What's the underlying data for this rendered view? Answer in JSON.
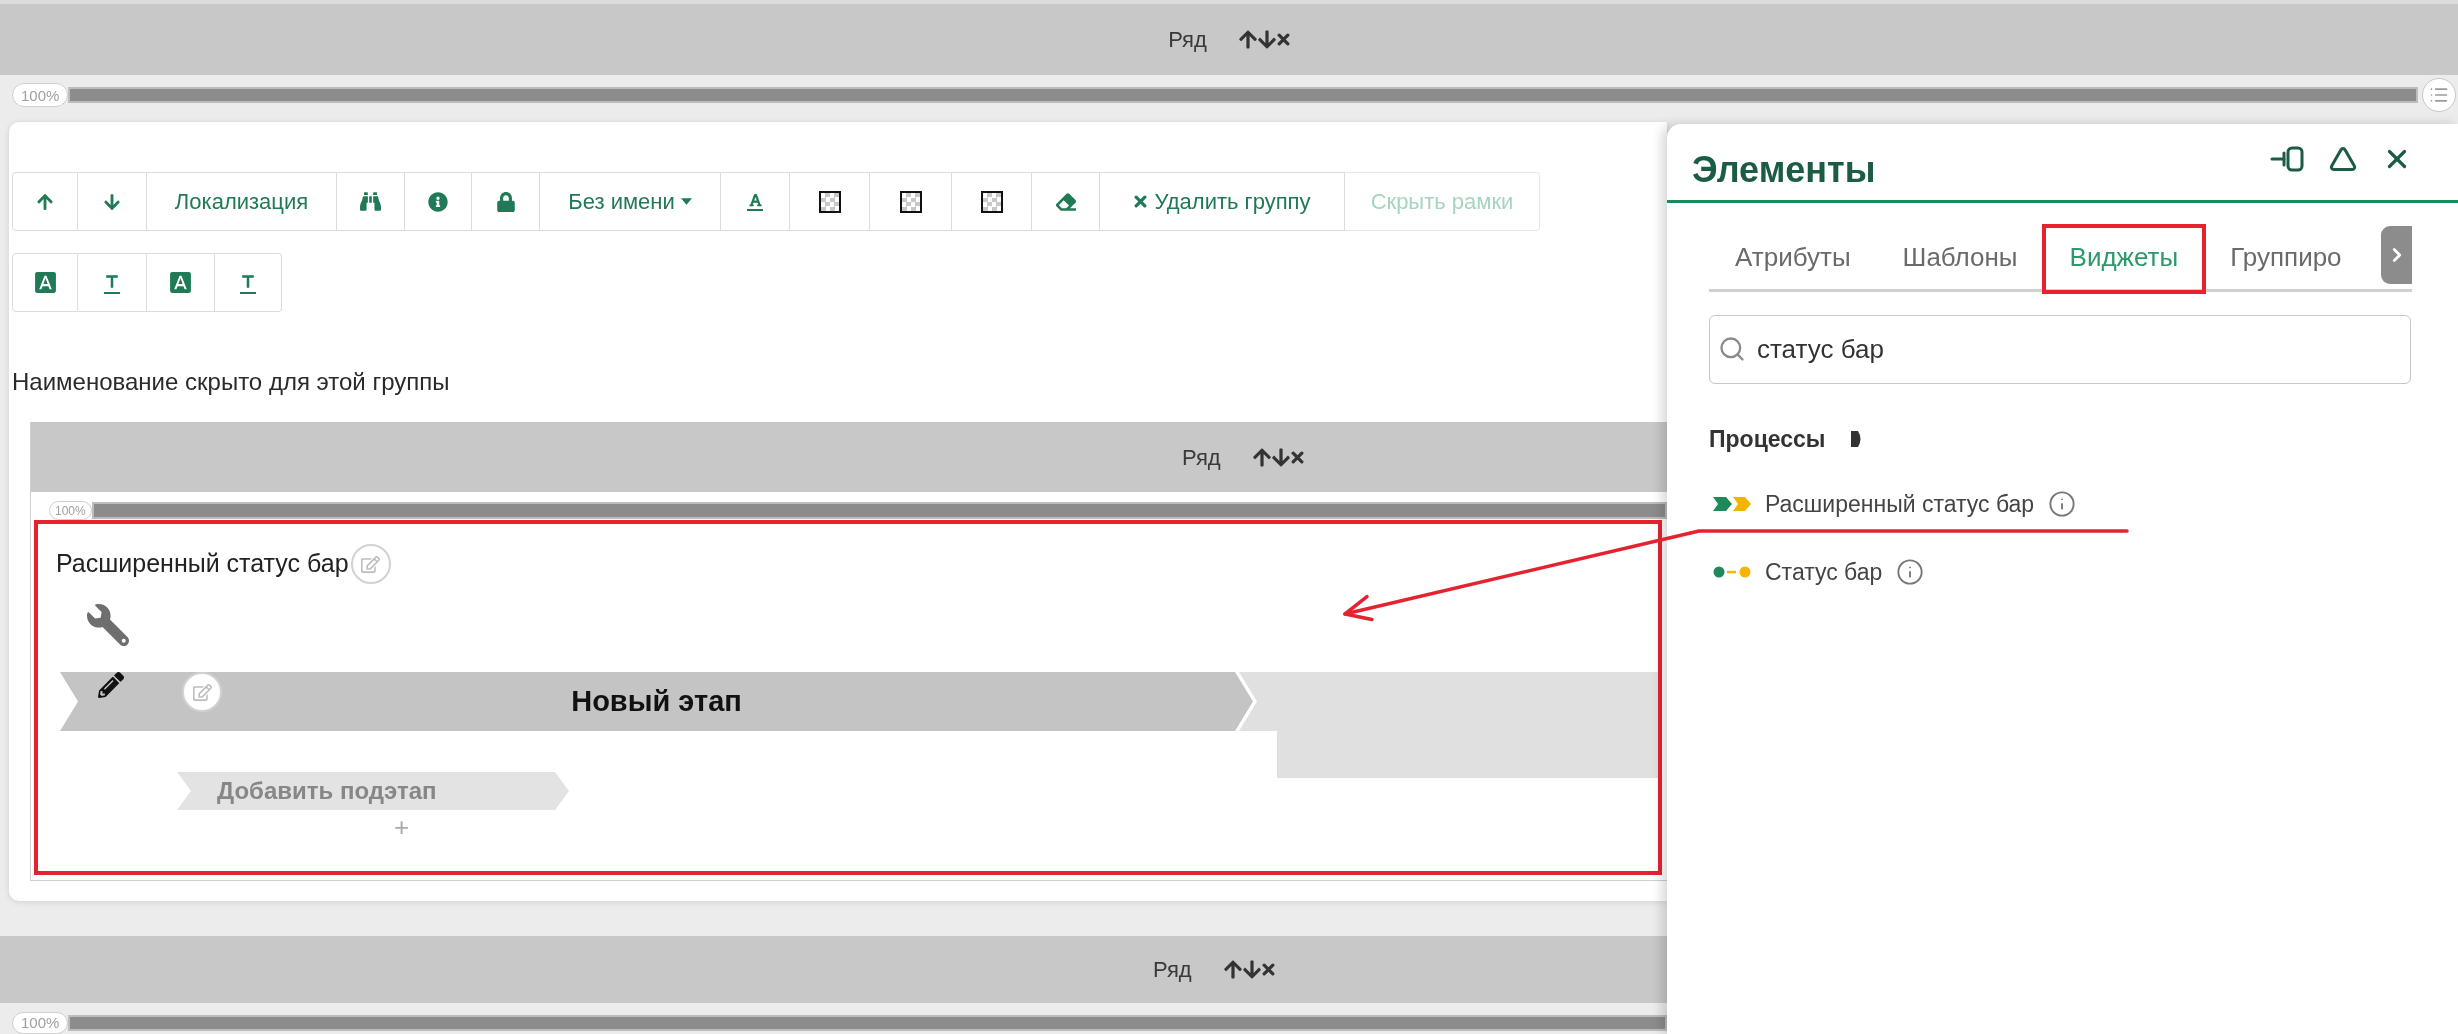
{
  "top_row": {
    "label": "Ряд",
    "width_badge": "100%",
    "level": 1
  },
  "group": {
    "toolbar": {
      "localization": "Локализация",
      "name_menu": "Без имени",
      "delete_group": "Удалить группу",
      "hide_frames": {
        "label": "Скрыть рамки",
        "disabled": true
      }
    },
    "caption": "Наименование скрыто для этой группы",
    "row": {
      "label": "Ряд",
      "width_badge": "100%",
      "level": 1
    },
    "widget": {
      "title": "Расширенный статус бар",
      "stage": {
        "label": "Новый этап"
      },
      "add_substage": "Добавить подэтап",
      "add_button": "+"
    }
  },
  "bottom_row": {
    "label": "Ряд",
    "width_badge": "100%",
    "level": 1
  },
  "panel": {
    "title": "Элементы",
    "tabs": [
      {
        "label": "Атрибуты",
        "selected": false
      },
      {
        "label": "Шаблоны",
        "selected": false
      },
      {
        "label": "Виджеты",
        "selected": true
      },
      {
        "label": "Группиро",
        "selected": false
      }
    ],
    "search": {
      "value": "статус бар"
    },
    "section": {
      "title": "Процессы",
      "items": [
        {
          "kind": "chevrons",
          "label": "Расширенный статус бар"
        },
        {
          "kind": "dots",
          "label": "Статус бар"
        }
      ]
    }
  }
}
